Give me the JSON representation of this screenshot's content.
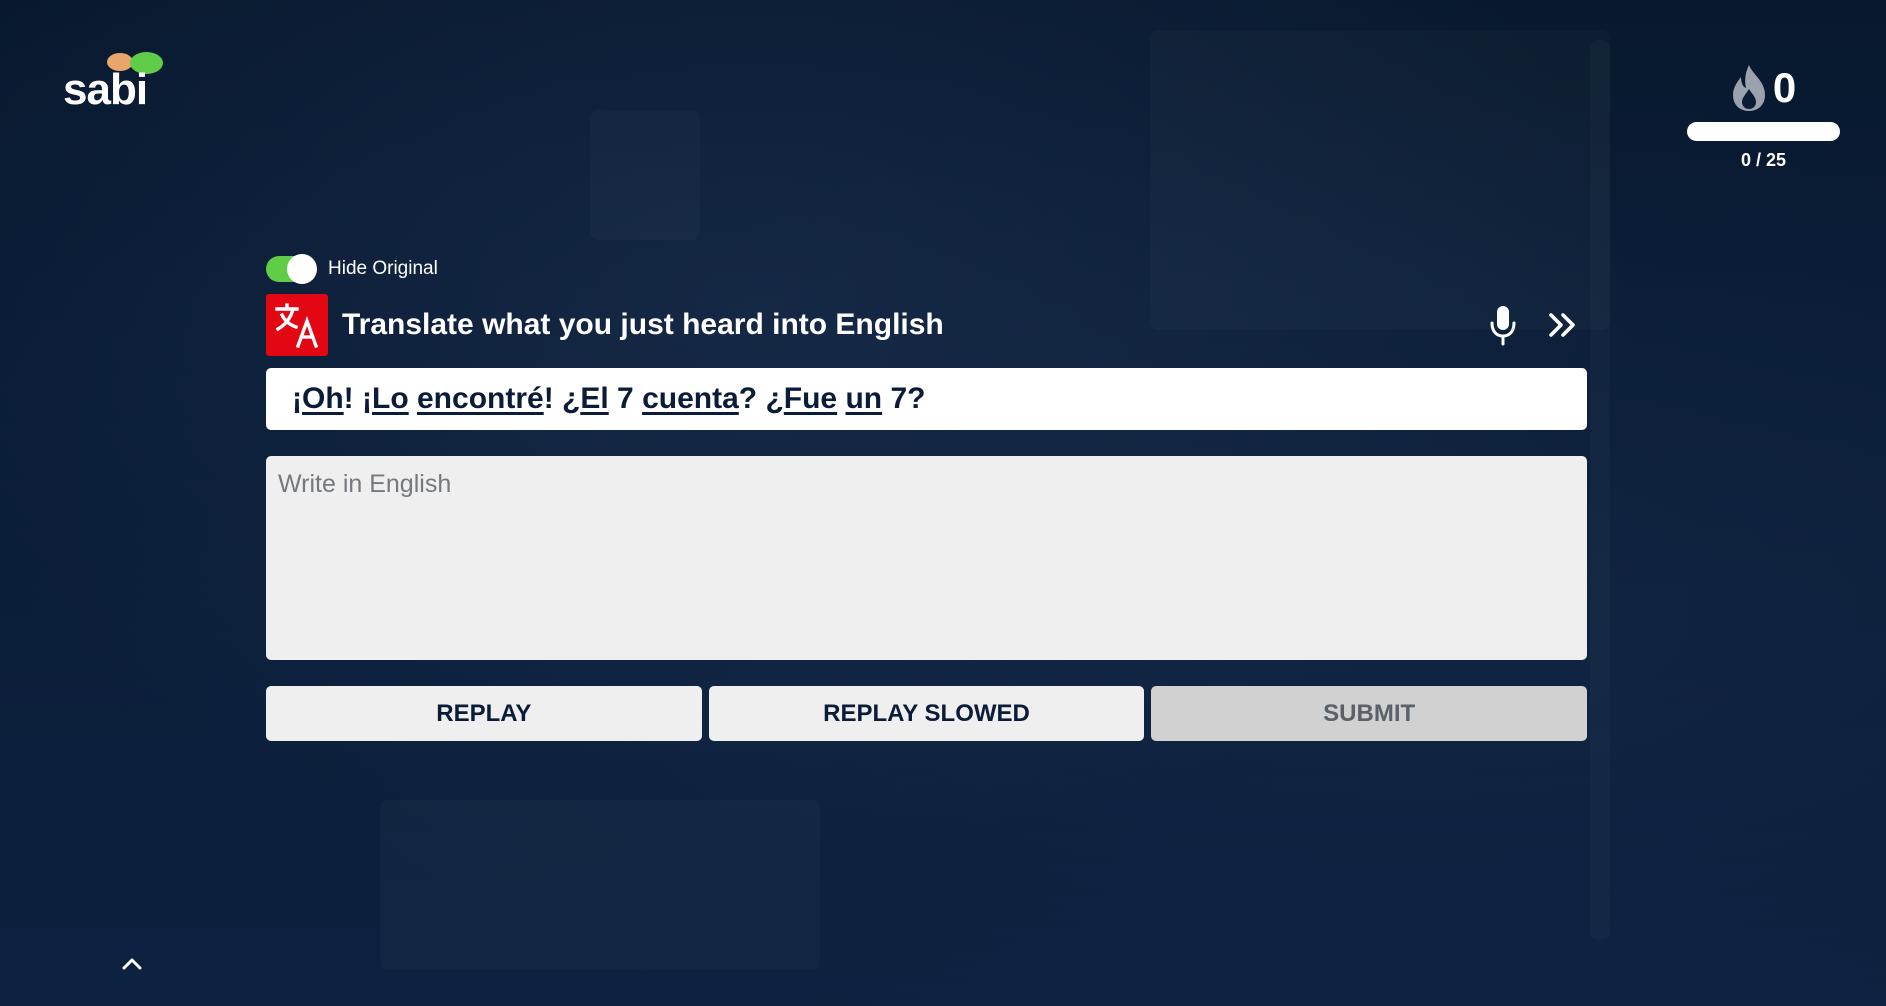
{
  "brand": {
    "logo_text": "sabi"
  },
  "streak": {
    "count": "0",
    "icon": "flame-icon"
  },
  "progress": {
    "label": "0 / 25",
    "fraction": 0
  },
  "toggle": {
    "label": "Hide Original",
    "on": true
  },
  "prompt": {
    "instruction": "Translate what you just heard into English",
    "badge_icon": "translate-icon"
  },
  "sentence": {
    "tokens": [
      {
        "text": "¡",
        "word": false
      },
      {
        "text": "Oh",
        "word": true
      },
      {
        "text": "! ¡",
        "word": false
      },
      {
        "text": "Lo",
        "word": true
      },
      {
        "text": " ",
        "word": false
      },
      {
        "text": "encontré",
        "word": true
      },
      {
        "text": "! ¿",
        "word": false
      },
      {
        "text": "El",
        "word": true
      },
      {
        "text": " 7 ",
        "word": false
      },
      {
        "text": "cuenta",
        "word": true
      },
      {
        "text": "? ¿",
        "word": false
      },
      {
        "text": "Fue",
        "word": true
      },
      {
        "text": " ",
        "word": false
      },
      {
        "text": "un",
        "word": true
      },
      {
        "text": " 7?",
        "word": false
      }
    ]
  },
  "answer": {
    "placeholder": "Write in English",
    "value": ""
  },
  "buttons": {
    "replay": "REPLAY",
    "replay_slowed": "REPLAY SLOWED",
    "submit": "SUBMIT"
  },
  "colors": {
    "background": "#0b1c38",
    "accent_green": "#5fcd47",
    "badge_red": "#e30613"
  }
}
